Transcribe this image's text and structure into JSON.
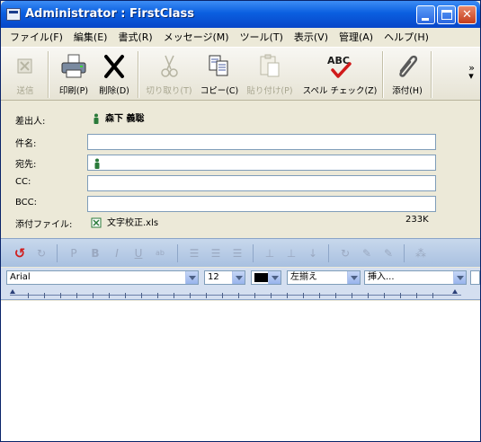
{
  "window": {
    "title": "Administrator : FirstClass"
  },
  "menu": {
    "items": [
      "ファイル(F)",
      "編集(E)",
      "書式(R)",
      "メッセージ(M)",
      "ツール(T)",
      "表示(V)",
      "管理(A)",
      "ヘルプ(H)"
    ]
  },
  "toolbar": {
    "send": "送信",
    "print": "印刷(P)",
    "delete": "削除(D)",
    "cut": "切り取り(T)",
    "copy": "コピー(C)",
    "paste": "貼り付け(P)",
    "spell": "スペル チェック(Z)",
    "attach": "添付(H)",
    "spell_icon_text": "ABC"
  },
  "header": {
    "from_label": "差出人:",
    "from_value": "森下 義聡",
    "subject_label": "件名:",
    "to_label": "宛先:",
    "cc_label": "CC:",
    "bcc_label": "BCC:",
    "attachment_label": "添付ファイル:",
    "attachment_name": "文字校正.xls",
    "attachment_size": "233K"
  },
  "format": {
    "font": "Arial",
    "size": "12",
    "align": "左揃え",
    "insert": "挿入..."
  },
  "colors": {
    "titlebar": "#0a5fe0",
    "chrome": "#ece9d8",
    "format_bar": "#b8cce6"
  }
}
